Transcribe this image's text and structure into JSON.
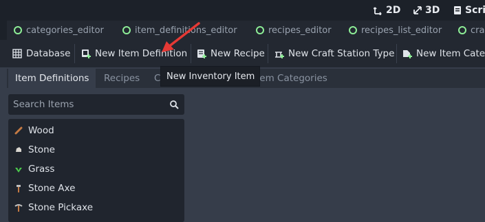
{
  "top_buttons": [
    {
      "label": "2D",
      "icon": "2d-view-icon"
    },
    {
      "label": "3D",
      "icon": "3d-view-icon"
    },
    {
      "label": "Scri",
      "icon": "script-icon"
    }
  ],
  "script_tabs": [
    {
      "label": "categories_editor"
    },
    {
      "label": "item_definitions_editor"
    },
    {
      "label": "recipes_editor"
    },
    {
      "label": "recipes_list_editor"
    },
    {
      "label": "cra"
    }
  ],
  "toolbar": {
    "database": "Database",
    "new_item_definition": "New Item Definition",
    "new_recipe": "New Recipe",
    "new_craft_station_type": "New Craft Station Type",
    "new_item_category": "New Item Categ"
  },
  "tooltip": "New Inventory Item",
  "subtabs": {
    "item_definitions": "Item Definitions",
    "recipes": "Recipes",
    "craft_partial": "Cr",
    "item_categories_partial": "tem Categories"
  },
  "search": {
    "placeholder": "Search Items"
  },
  "items": [
    {
      "label": "Wood",
      "icon": "wood-icon"
    },
    {
      "label": "Stone",
      "icon": "stone-icon"
    },
    {
      "label": "Grass",
      "icon": "grass-icon"
    },
    {
      "label": "Stone Axe",
      "icon": "axe-icon"
    },
    {
      "label": "Stone Pickaxe",
      "icon": "pickaxe-icon"
    }
  ],
  "colors": {
    "accent_green": "#8eef97",
    "arrow_red": "#e53935"
  }
}
